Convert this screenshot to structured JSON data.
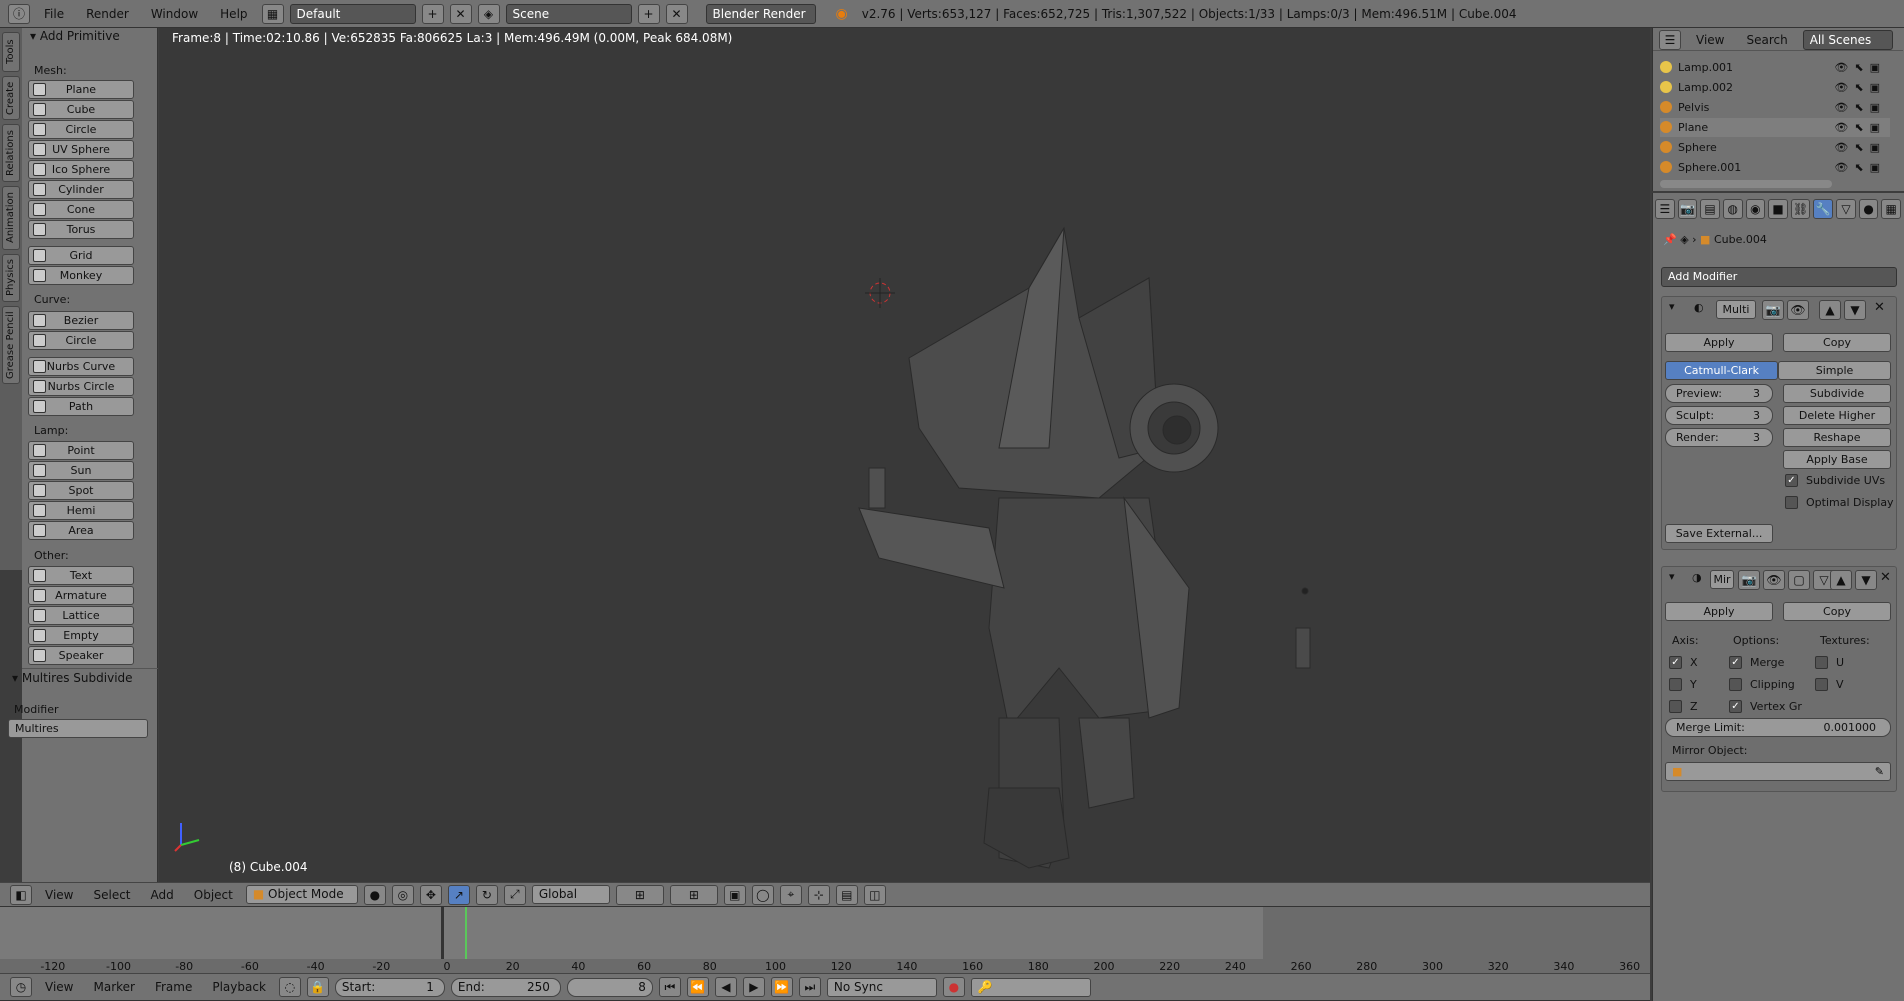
{
  "topbar": {
    "menus": [
      "File",
      "Render",
      "Window",
      "Help"
    ],
    "layout": "Default",
    "scene": "Scene",
    "engine": "Blender Render",
    "stats": "v2.76 | Verts:653,127 | Faces:652,725 | Tris:1,307,522 | Objects:1/33 | Lamps:0/3 | Mem:496.51M | Cube.004"
  },
  "tabs": [
    "Tools",
    "Create",
    "Relations",
    "Animation",
    "Physics",
    "Grease Pencil"
  ],
  "toolshelf": {
    "panel_title": "Add Primitive",
    "mesh_label": "Mesh:",
    "mesh": [
      "Plane",
      "Cube",
      "Circle",
      "UV Sphere",
      "Ico Sphere",
      "Cylinder",
      "Cone",
      "Torus",
      "Grid",
      "Monkey"
    ],
    "curve_label": "Curve:",
    "curve": [
      "Bezier",
      "Circle",
      "Nurbs Curve",
      "Nurbs Circle",
      "Path"
    ],
    "lamp_label": "Lamp:",
    "lamp": [
      "Point",
      "Sun",
      "Spot",
      "Hemi",
      "Area"
    ],
    "other_label": "Other:",
    "other": [
      "Text",
      "Armature",
      "Lattice",
      "Empty",
      "Speaker"
    ],
    "operator_title": "Multires Subdivide",
    "modifier_label": "Modifier",
    "modifier_value": "Multires"
  },
  "viewport": {
    "info": "Frame:8 | Time:02:10.86 | Ve:652835 Fa:806625 La:3 | Mem:496.49M (0.00M, Peak 684.08M)",
    "object_label": "(8) Cube.004"
  },
  "view3d_header": {
    "menus": [
      "View",
      "Select",
      "Add",
      "Object"
    ],
    "mode": "Object Mode",
    "orientation": "Global"
  },
  "timeline": {
    "ticks": [
      "-120",
      "-100",
      "-80",
      "-60",
      "-40",
      "-20",
      "0",
      "20",
      "40",
      "60",
      "80",
      "100",
      "120",
      "140",
      "160",
      "180",
      "200",
      "220",
      "240",
      "260",
      "280",
      "300",
      "320",
      "340",
      "360"
    ],
    "menus": [
      "View",
      "Marker",
      "Frame",
      "Playback"
    ],
    "start_label": "Start:",
    "start_value": "1",
    "end_label": "End:",
    "end_value": "250",
    "current": "8",
    "sync": "No Sync"
  },
  "outliner": {
    "menus": [
      "View",
      "Search"
    ],
    "scope": "All Scenes",
    "items": [
      {
        "name": "Lamp.001",
        "kind": "lamp"
      },
      {
        "name": "Lamp.002",
        "kind": "lamp"
      },
      {
        "name": "Pelvis",
        "kind": "mesh"
      },
      {
        "name": "Plane",
        "kind": "mesh"
      },
      {
        "name": "Sphere",
        "kind": "mesh"
      },
      {
        "name": "Sphere.001",
        "kind": "mesh"
      }
    ]
  },
  "properties": {
    "object": "Cube.004",
    "add_modifier": "Add Modifier",
    "multires": {
      "name": "Multi",
      "apply": "Apply",
      "copy": "Copy",
      "type_a": "Catmull-Clark",
      "type_b": "Simple",
      "preview_label": "Preview:",
      "preview": "3",
      "sculpt_label": "Sculpt:",
      "sculpt": "3",
      "render_label": "Render:",
      "render": "3",
      "subdivide": "Subdivide",
      "delete_higher": "Delete Higher",
      "reshape": "Reshape",
      "apply_base": "Apply Base",
      "subdivide_uvs": "Subdivide UVs",
      "optimal_display": "Optimal Display",
      "save_external": "Save External..."
    },
    "mirror": {
      "name": "Mir",
      "apply": "Apply",
      "copy": "Copy",
      "axis_label": "Axis:",
      "options_label": "Options:",
      "textures_label": "Textures:",
      "x": "X",
      "y": "Y",
      "z": "Z",
      "merge": "Merge",
      "clipping": "Clipping",
      "vertex_groups": "Vertex Gr",
      "u": "U",
      "v": "V",
      "merge_limit_label": "Merge Limit:",
      "merge_limit": "0.001000",
      "mirror_object_label": "Mirror Object:"
    }
  },
  "colors": {
    "accent": "#5680c2",
    "panel": "#727272",
    "viewport": "#393939"
  }
}
